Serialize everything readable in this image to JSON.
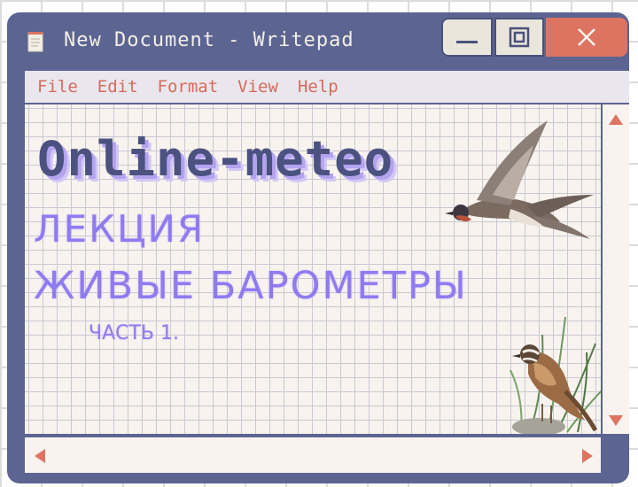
{
  "window": {
    "title": "New Document - Writepad",
    "icon": "document-icon",
    "controls": [
      "minimize-icon",
      "maximize-icon",
      "close-icon"
    ]
  },
  "menu": {
    "items": [
      "File",
      "Edit",
      "Format",
      "View",
      "Help"
    ]
  },
  "document": {
    "heading": "Online-meteo",
    "line1": "ЛЕКЦИЯ",
    "line2": "ЖИВЫЕ БАРОМЕТРЫ",
    "line3": "ЧАСТЬ 1.",
    "images": [
      "swallow-image",
      "bunting-image"
    ]
  },
  "colors": {
    "window_frame": "#5c6491",
    "menu_text": "#d76a5b",
    "close_button": "#dd7461",
    "heading_text": "#4c5280",
    "lecture_text": "#8f7bf0",
    "paper": "#f8f3ee"
  }
}
